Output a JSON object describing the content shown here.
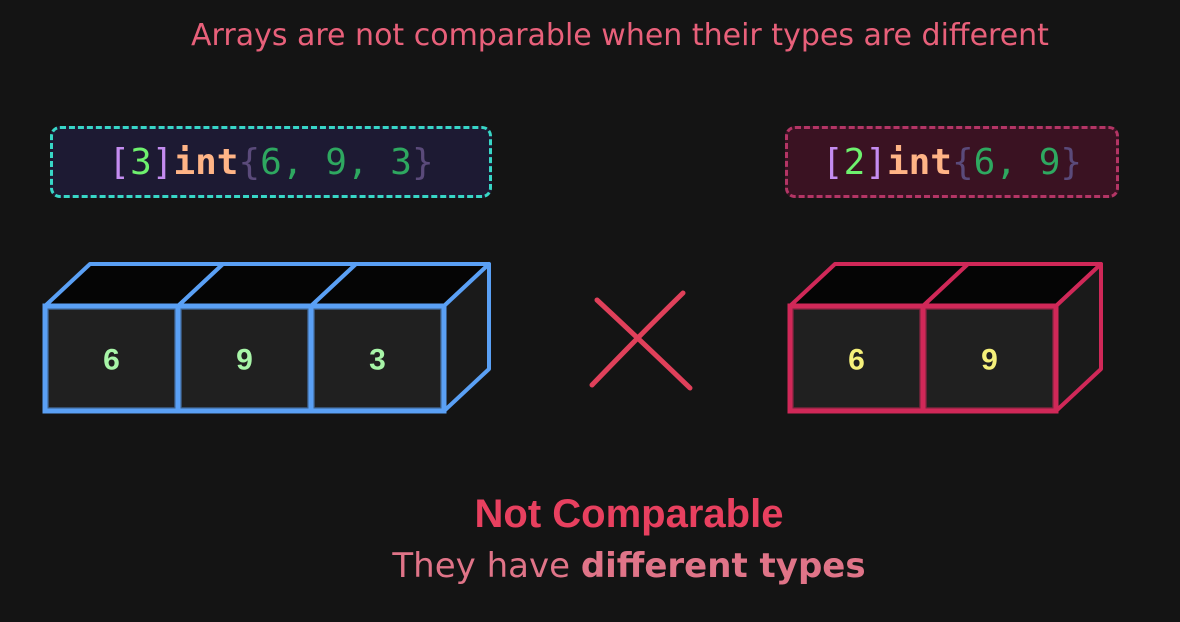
{
  "title": "Arrays are not comparable when their types are different",
  "left_array": {
    "open_bracket": "[",
    "length": "3",
    "close_bracket": "]",
    "type": "int",
    "open_brace": "{",
    "values": [
      "6",
      "9",
      "3"
    ],
    "close_brace": "}",
    "box_values": [
      "6",
      "9",
      "3"
    ],
    "box_color": "#5aa0f5",
    "value_color": "#a8f5a8"
  },
  "right_array": {
    "open_bracket": "[",
    "length": "2",
    "close_bracket": "]",
    "type": "int",
    "open_brace": "{",
    "values": [
      "6",
      "9"
    ],
    "close_brace": "}",
    "box_values": [
      "6",
      "9"
    ],
    "box_color": "#d02858",
    "value_color": "#f5f07a"
  },
  "separator_icon": "cross-icon",
  "verdict": {
    "heading": "Not Comparable",
    "subtitle_prefix": "They have ",
    "subtitle_emphasis": "different types"
  },
  "colors": {
    "background": "#141414",
    "accent": "#e8405f",
    "left_border": "#38d6c6",
    "right_border": "#b33565"
  }
}
